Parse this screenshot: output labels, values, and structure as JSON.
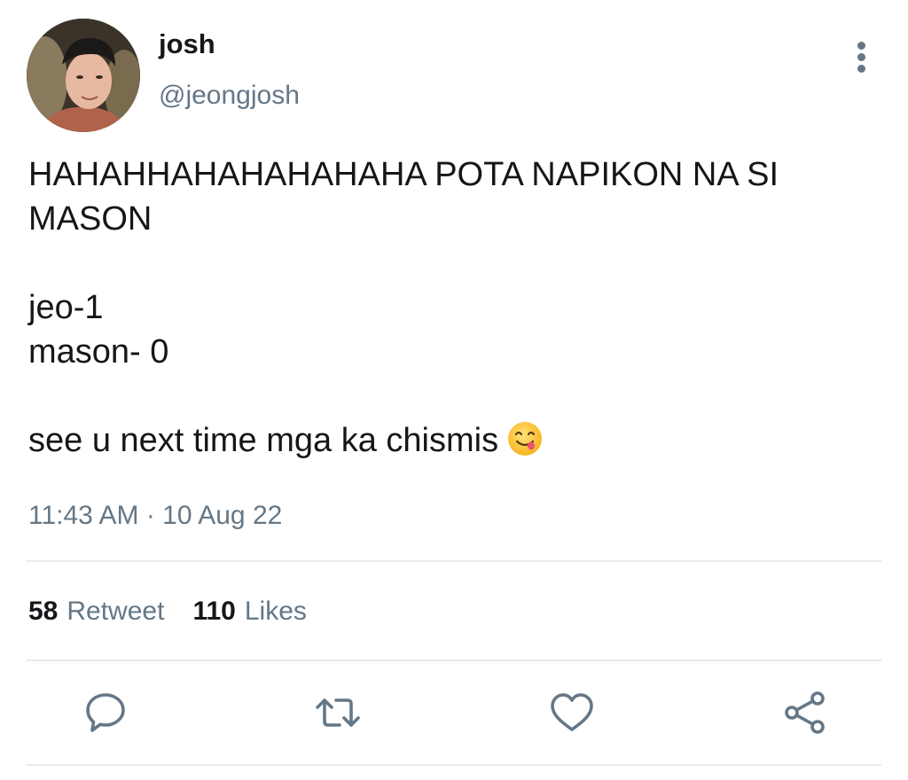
{
  "user": {
    "display_name": "josh",
    "handle": "@jeongjosh",
    "avatar_icon": "user-avatar"
  },
  "tweet": {
    "lines": [
      "HAHAHHAHAHAHAHAHA POTA NAPIKON NA SI MASON",
      "jeo-1",
      "mason- 0",
      "see u next time mga ka chismis"
    ],
    "emoji": "face-savoring-food-icon",
    "timestamp": "11:43 AM · 10 Aug 22"
  },
  "stats": {
    "retweet_count": "58",
    "retweet_label": "Retweet",
    "likes_count": "110",
    "likes_label": "Likes"
  },
  "actions": {
    "reply_icon": "comment-icon",
    "retweet_icon": "retweet-icon",
    "like_icon": "heart-icon",
    "share_icon": "share-icon"
  },
  "colors": {
    "text_primary": "#14171a",
    "text_secondary": "#657786",
    "divider": "#e6ecf0"
  }
}
